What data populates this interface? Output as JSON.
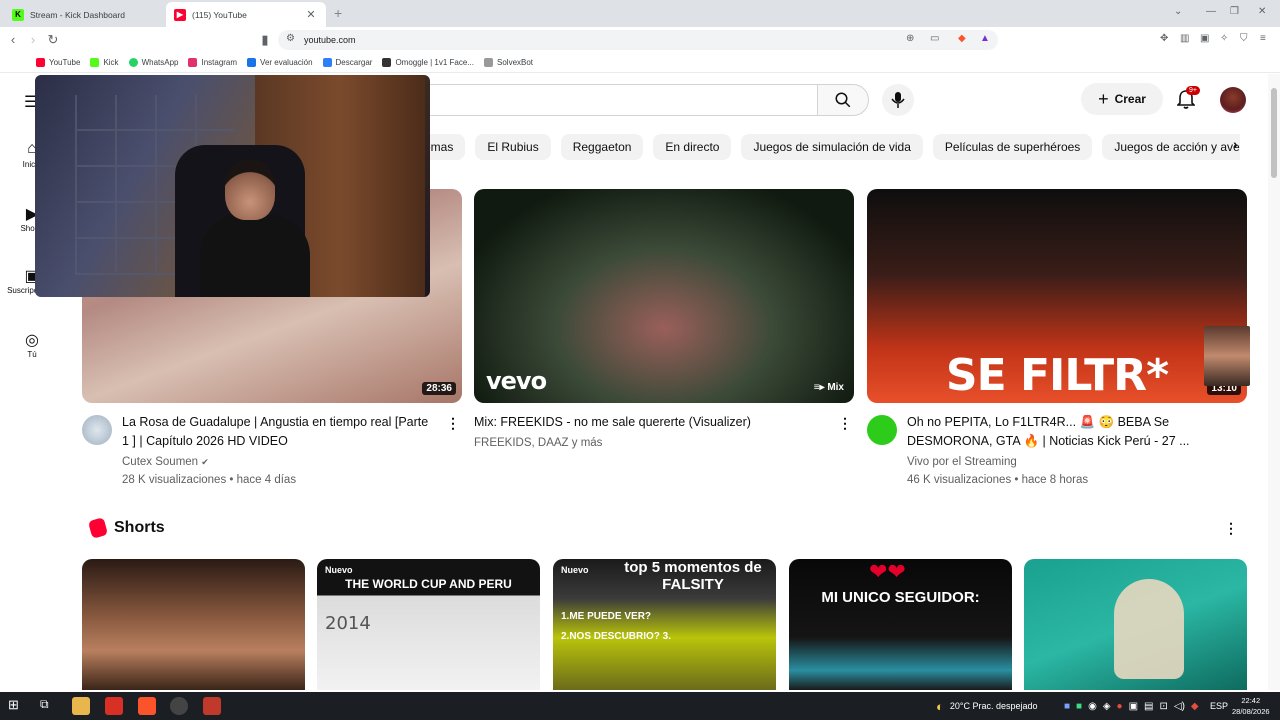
{
  "browser": {
    "tabs": [
      {
        "label": "Stream - Kick Dashboard",
        "favicon_color": "#53fc18"
      },
      {
        "label": "(115) YouTube",
        "favicon_color": "#ff0033"
      }
    ],
    "url": "youtube.com",
    "bookmarks": [
      {
        "label": "YouTube",
        "color": "#ff0033"
      },
      {
        "label": "Kick",
        "color": "#53fc18"
      },
      {
        "label": "WhatsApp",
        "color": "#25d366"
      },
      {
        "label": "Instagram",
        "color": "#e1306c"
      },
      {
        "label": "Ver evaluación",
        "color": "#1a73e8"
      },
      {
        "label": "Descargar",
        "color": "#2d7ff9"
      },
      {
        "label": "Omoggle | 1v1 Face...",
        "color": "#333333"
      },
      {
        "label": "SolvexBot",
        "color": "#999999"
      }
    ]
  },
  "youtube": {
    "create_label": "Crear",
    "notification_count": "9+",
    "nav": [
      {
        "label": "Inicio",
        "icon": "home-icon"
      },
      {
        "label": "Shorts",
        "icon": "shorts-icon"
      },
      {
        "label": "Suscripciones",
        "icon": "subscriptions-icon"
      },
      {
        "label": "Tú",
        "icon": "user-icon"
      }
    ],
    "chips": [
      "Temas",
      "El Rubius",
      "Reggaeton",
      "En directo",
      "Juegos de simulación de vida",
      "Películas de superhéroes",
      "Juegos de acción y aventuras"
    ],
    "videos": [
      {
        "title": "La Rosa de Guadalupe | Angustia en tiempo real [Parte 1 ] | Capítulo 2026 HD VIDEO",
        "channel": "Cutex Soumen",
        "verified": true,
        "stats": "28 K visualizaciones • hace 4 días",
        "duration": "28:36"
      },
      {
        "title": "Mix: FREEKIDS - no me sale quererte (Visualizer)",
        "channel": "FREEKIDS, DAAZ y más",
        "stats": "",
        "duration": "Mix",
        "overlay": "vevo"
      },
      {
        "title": "Oh no PEPITA, Lo F1LTR4R... 🚨 😳 BEBA Se DESMORONA, GTA 🔥 | Noticias Kick Perú - 27 ...",
        "channel": "Vivo por el Streaming",
        "stats": "46 K visualizaciones • hace 8 horas",
        "duration": "13:10",
        "overlay": "SE FILTR*"
      }
    ],
    "shorts_title": "Shorts",
    "shorts": [
      {
        "badge": "",
        "text": ""
      },
      {
        "badge": "Nuevo",
        "text": "THE WORLD CUP AND PERU",
        "sub": "2014"
      },
      {
        "badge": "Nuevo",
        "text": "top 5 momentos de FALSITY",
        "sub": "1.ME PUEDE VER? 2.NOS DESCUBRIO? 3."
      },
      {
        "badge": "",
        "text": "MI UNICO SEGUIDOR:"
      },
      {
        "badge": "",
        "text": ""
      }
    ]
  },
  "taskbar": {
    "weather": "20°C  Prac. despejado",
    "language": "ESP",
    "time": "22:42",
    "date": "28/08/2026"
  }
}
